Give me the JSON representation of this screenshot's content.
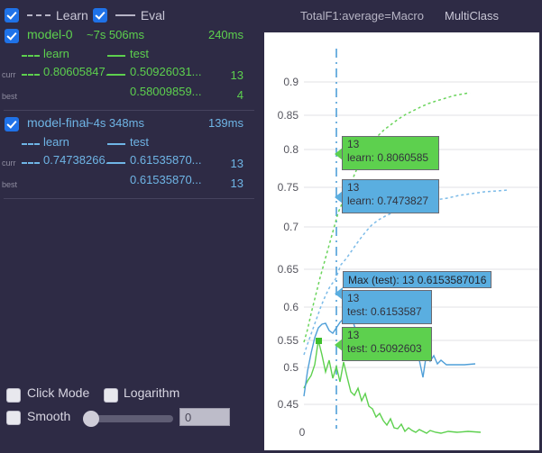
{
  "legend": {
    "learn_checkbox_checked": true,
    "learn_label": "Learn",
    "eval_checkbox_checked": true,
    "eval_label": "Eval"
  },
  "models": [
    {
      "checked": true,
      "name": "model-0",
      "duration": "~7s 506ms",
      "iter_time": "240ms",
      "color": "#5dd04e",
      "series_learn_label": "learn",
      "series_test_label": "test",
      "curr_tag": "curr",
      "curr_learn": "0.80605847...",
      "curr_test": "0.50926031...",
      "curr_index": "13",
      "best_tag": "best",
      "best_test": "0.58009859...",
      "best_index": "4"
    },
    {
      "checked": true,
      "name": "model-final",
      "duration": "~4s 348ms",
      "iter_time": "139ms",
      "color": "#6fb5e6",
      "series_learn_label": "learn",
      "series_test_label": "test",
      "curr_tag": "curr",
      "curr_learn": "0.74738266...",
      "curr_test": "0.61535870...",
      "curr_index": "13",
      "best_tag": "best",
      "best_test": "0.61535870...",
      "best_index": "13"
    }
  ],
  "controls": {
    "click_mode_label": "Click Mode",
    "click_mode_checked": false,
    "logarithm_label": "Logarithm",
    "logarithm_checked": false,
    "smooth_label": "Smooth",
    "smooth_checked": false,
    "smooth_value": "0"
  },
  "chart_header": {
    "metric": "TotalF1:average=Macro",
    "mode": "MultiClass"
  },
  "tooltips": [
    {
      "id": "learn-green",
      "line1": "13",
      "line2": "learn: 0.8060585",
      "variant": "g"
    },
    {
      "id": "learn-blue",
      "line1": "13",
      "line2": "learn: 0.7473827",
      "variant": "b"
    },
    {
      "id": "max-test",
      "text": "Max (test): 13 0.6153587016",
      "variant": "b"
    },
    {
      "id": "test-blue",
      "line1": "13",
      "line2": "test: 0.6153587",
      "variant": "b"
    },
    {
      "id": "test-green",
      "line1": "13",
      "line2": "test: 0.5092603",
      "variant": "g"
    }
  ],
  "chart_data": {
    "type": "line",
    "title": "TotalF1:average=Macro",
    "subtitle": "MultiClass",
    "xlabel": "",
    "ylabel": "",
    "grid": true,
    "legend_position": "left-panel",
    "ylim": [
      0.43,
      0.93
    ],
    "yticks": [
      0.45,
      0.5,
      0.55,
      0.6,
      0.65,
      0.7,
      0.75,
      0.8,
      0.85,
      0.9
    ],
    "ytick_labels": [
      "0.45",
      "0.5",
      "0.55",
      "0.6",
      "0.65",
      "0.7",
      "0.75",
      "0.8",
      "0.85",
      "0.9"
    ],
    "xticks": [
      0
    ],
    "xtick_labels": [
      "0"
    ],
    "cursor_x": 13,
    "series": [
      {
        "name": "model-0 learn",
        "color": "#5dd04e",
        "style": "dashed",
        "x": [
          0,
          1,
          2,
          3,
          4,
          5,
          6,
          7,
          8,
          9,
          10,
          11,
          12,
          13,
          14,
          15,
          16,
          17,
          18,
          19,
          20,
          21,
          22,
          23,
          24,
          25,
          26
        ],
        "values": [
          0.578,
          0.596,
          0.622,
          0.648,
          0.672,
          0.693,
          0.712,
          0.728,
          0.742,
          0.755,
          0.767,
          0.778,
          0.792,
          0.8060585,
          0.815,
          0.823,
          0.83,
          0.836,
          0.842,
          0.848,
          0.853,
          0.858,
          0.862,
          0.866,
          0.87,
          0.873,
          0.876
        ]
      },
      {
        "name": "model-final learn",
        "color": "#6fb5e6",
        "style": "dashed",
        "x": [
          0,
          1,
          2,
          3,
          4,
          5,
          6,
          7,
          8,
          9,
          10,
          11,
          12,
          13,
          14,
          15,
          16,
          17,
          18,
          19,
          20,
          21,
          22,
          23,
          24,
          25,
          26
        ],
        "values": [
          0.565,
          0.582,
          0.6,
          0.618,
          0.635,
          0.65,
          0.663,
          0.674,
          0.693,
          0.702,
          0.714,
          0.726,
          0.737,
          0.7473827,
          0.754,
          0.759,
          0.764,
          0.768,
          0.772,
          0.775,
          0.778,
          0.781,
          0.784,
          0.787,
          0.789,
          0.791,
          0.793
        ]
      },
      {
        "name": "model-0 test",
        "color": "#5dd04e",
        "style": "solid",
        "x": [
          0,
          1,
          2,
          3,
          4,
          5,
          6,
          7,
          8,
          9,
          10,
          11,
          12,
          13,
          14,
          15,
          16,
          17,
          18,
          19,
          20,
          21,
          22,
          23,
          24,
          25,
          26,
          27,
          28,
          29,
          30,
          31,
          32,
          33,
          34,
          35,
          36,
          37,
          38,
          39,
          40
        ],
        "values": [
          0.512,
          0.522,
          0.53,
          0.546,
          0.58,
          0.56,
          0.536,
          0.552,
          0.527,
          0.543,
          0.522,
          0.549,
          0.528,
          0.5092603,
          0.504,
          0.513,
          0.497,
          0.506,
          0.491,
          0.488,
          0.477,
          0.481,
          0.472,
          0.466,
          0.474,
          0.463,
          0.461,
          0.468,
          0.458,
          0.462,
          0.459,
          0.456,
          0.46,
          0.457,
          0.455,
          0.458,
          0.456,
          0.455,
          0.456,
          0.457,
          0.456
        ]
      },
      {
        "name": "model-final test",
        "color": "#6fb5e6",
        "style": "solid",
        "x": [
          0,
          1,
          2,
          3,
          4,
          5,
          6,
          7,
          8,
          9,
          10,
          11,
          12,
          13,
          14,
          15,
          16,
          17,
          18,
          19,
          20,
          21,
          22,
          23,
          24,
          25,
          26,
          27,
          28,
          29,
          30,
          31,
          32,
          33,
          34,
          35,
          36,
          37,
          38,
          39,
          40
        ],
        "values": [
          0.5,
          0.536,
          0.56,
          0.582,
          0.596,
          0.601,
          0.603,
          0.592,
          0.588,
          0.596,
          0.603,
          0.608,
          0.611,
          0.6153587,
          0.598,
          0.586,
          0.594,
          0.571,
          0.579,
          0.568,
          0.584,
          0.574,
          0.558,
          0.566,
          0.556,
          0.559,
          0.553,
          0.556,
          0.549,
          0.553,
          0.551,
          0.562,
          0.548,
          0.523,
          0.556,
          0.545,
          0.552,
          0.541,
          0.546,
          0.54,
          0.54
        ]
      }
    ],
    "markers": [
      {
        "series": "model-0 test",
        "x": 4,
        "y": 0.58009859,
        "label": "best"
      },
      {
        "series": "model-final test",
        "x": 13,
        "y": 0.6153587016,
        "label": "max"
      }
    ]
  }
}
